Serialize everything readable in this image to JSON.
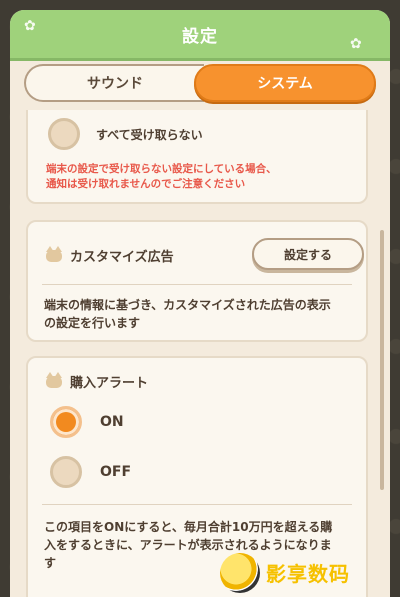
{
  "header": {
    "title": "設定"
  },
  "tabs": [
    {
      "label": "サウンド",
      "active": false
    },
    {
      "label": "システム",
      "active": true
    }
  ],
  "notification_section": {
    "option_label": "すべて受け取らない",
    "warning_line1": "端末の設定で受け取らない設定にしている場合、",
    "warning_line2": "通知は受け取れませんのでご注意ください"
  },
  "custom_ads": {
    "title": "カスタマイズ広告",
    "button_label": "設定する",
    "description_line1": "端末の情報に基づき、カスタマイズされた広告の表示",
    "description_line2": "の設定を行います"
  },
  "purchase_alert": {
    "title": "購入アラート",
    "options": [
      {
        "label": "ON",
        "selected": true
      },
      {
        "label": "OFF",
        "selected": false
      }
    ],
    "description_line1": "この項目をONにすると、毎月合計10万円を超える購",
    "description_line2": "入をするときに、アラートが表示されるようになりま",
    "description_line3": "す"
  },
  "watermark": {
    "text": "影享数码"
  },
  "colors": {
    "header_green": "#9fd27b",
    "accent_orange": "#f7922e",
    "warning_red": "#e8584a",
    "panel_bg": "#f4ebdd"
  }
}
